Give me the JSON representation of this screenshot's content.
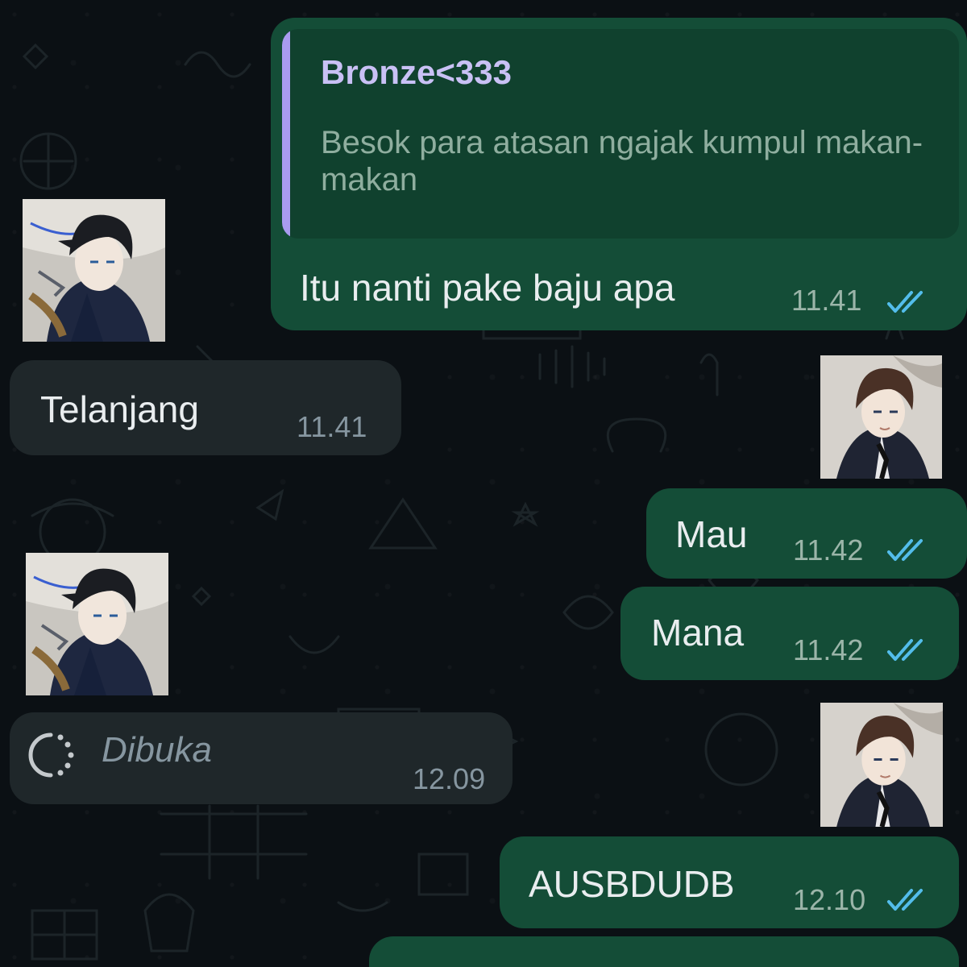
{
  "chat": {
    "quoted_reply": {
      "author": "Bronze<333",
      "text": "Besok para atasan ngajak kumpul makan-makan"
    },
    "messages": [
      {
        "direction": "outgoing",
        "text": "Itu nanti pake baju apa",
        "time": "11.41",
        "status": "read"
      },
      {
        "direction": "incoming",
        "text": "Telanjang",
        "time": "11.41"
      },
      {
        "direction": "outgoing",
        "text": "Mau",
        "time": "11.42",
        "status": "read"
      },
      {
        "direction": "outgoing",
        "text": "Mana",
        "time": "11.42",
        "status": "read"
      },
      {
        "direction": "incoming",
        "text": "Dibuka",
        "time": "12.09",
        "state": "loading"
      },
      {
        "direction": "outgoing",
        "text": "AUSBDUDB",
        "time": "12.10",
        "status": "read"
      }
    ]
  },
  "icons": {
    "read_receipt": "double-check-icon",
    "loading": "loading-spinner-icon",
    "avatar_incoming": "dark-haired-anime-avatar",
    "avatar_outgoing": "brown-haired-anime-avatar"
  },
  "colors": {
    "background": "#0b1014",
    "outgoing_bubble": "#144d37",
    "incoming_bubble": "#1f272a",
    "quote_bar": "#a99bf0",
    "read_tick": "#53bdeb",
    "text": "#e9edef",
    "timestamp": "#8696a0"
  }
}
